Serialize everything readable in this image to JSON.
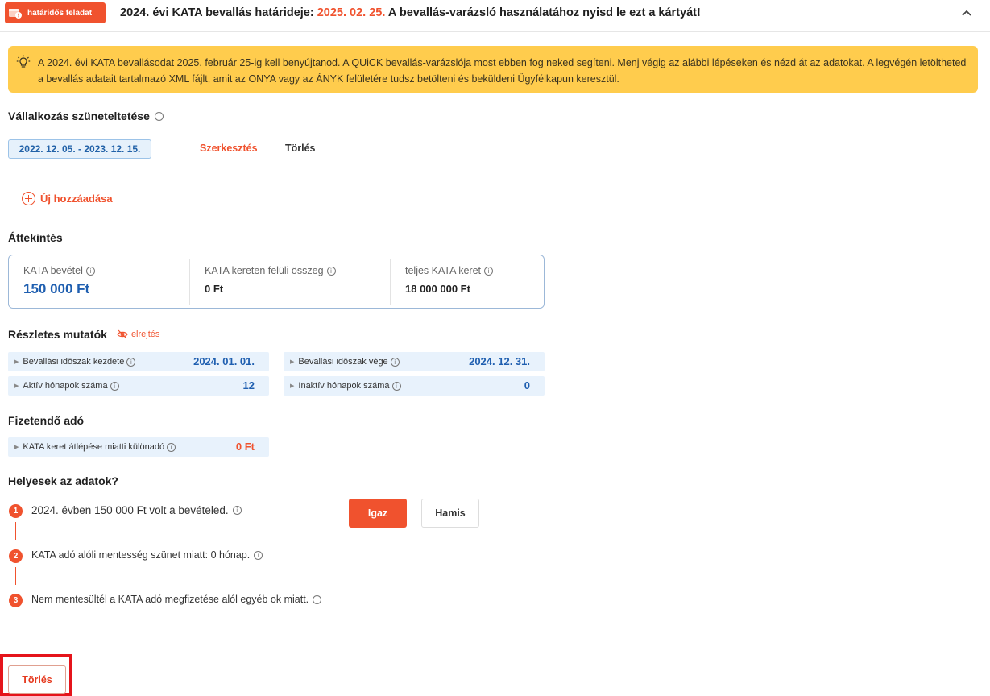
{
  "topbar": {
    "badge_label": "határidős feladat",
    "title_prefix": "2024. évi KATA bevallás határideje:",
    "title_date": "2025. 02. 25.",
    "title_suffix": "A bevallás-varázsló használatához nyisd le ezt a kártyát!"
  },
  "notice": {
    "text": "A 2024. évi KATA bevallásodat 2025. február 25-ig kell benyújtanod. A QUiCK bevallás-varázslója most ebben fog neked segíteni. Menj végig az alábbi lépéseken és nézd át az adatokat. A legvégén letöltheted a bevallás adatait tartalmazó XML fájlt, amit az ONYA vagy az ÁNYK felületére tudsz betölteni és beküldeni Ügyfélkapun keresztül."
  },
  "suspension": {
    "title": "Vállalkozás szüneteltetése",
    "period": "2022. 12. 05. - 2023. 12. 15.",
    "edit_label": "Szerkesztés",
    "delete_label": "Törlés",
    "add_label": "Új hozzáadása"
  },
  "overview": {
    "title": "Áttekintés",
    "cells": [
      {
        "label": "KATA bevétel",
        "value": "150 000 Ft"
      },
      {
        "label": "KATA kereten felüli összeg",
        "value": "0 Ft"
      },
      {
        "label": "teljes KATA keret",
        "value": "18 000 000 Ft"
      }
    ]
  },
  "details": {
    "title": "Részletes mutatók",
    "hide_label": "elrejtés",
    "metrics": [
      {
        "label": "Bevallási időszak kezdete",
        "value": "2024. 01. 01."
      },
      {
        "label": "Bevallási időszak vége",
        "value": "2024. 12. 31."
      },
      {
        "label": "Aktív hónapok száma",
        "value": "12"
      },
      {
        "label": "Inaktív hónapok száma",
        "value": "0"
      }
    ]
  },
  "tax": {
    "title": "Fizetendő adó",
    "label": "KATA keret átlépése miatti különadó",
    "value": "0 Ft"
  },
  "check": {
    "title": "Helyesek az adatok?",
    "steps": [
      {
        "num": "1",
        "text": "2024. évben 150 000 Ft volt a bevételed."
      },
      {
        "num": "2",
        "text": "KATA adó alóli mentesség szünet miatt: 0 hónap."
      },
      {
        "num": "3",
        "text": "Nem mentesültél a KATA adó megfizetése alól egyéb ok miatt."
      }
    ],
    "true_label": "Igaz",
    "false_label": "Hamis"
  },
  "footer": {
    "delete_label": "Törlés"
  },
  "colors": {
    "accent": "#f0522e",
    "notice_bg": "#ffcc4d",
    "value_blue": "#1f5fb0",
    "chip_bg": "#e6f1fb",
    "highlight_red": "#e5141b"
  }
}
